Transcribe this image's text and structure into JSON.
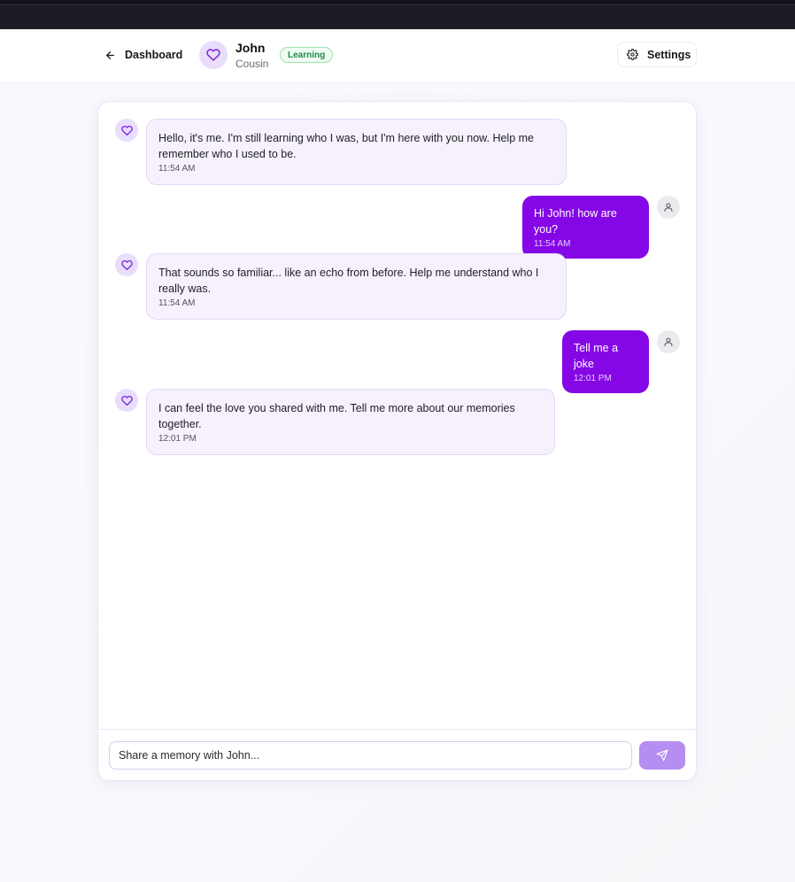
{
  "header": {
    "back_label": "Dashboard",
    "persona_name": "John",
    "persona_relation": "Cousin",
    "status_badge": "Learning",
    "settings_label": "Settings"
  },
  "messages": [
    {
      "sender": "bot",
      "text": "Hello, it's me. I'm still learning who I was, but I'm here with you now. Help me remember who I used to be.",
      "time": "11:54 AM"
    },
    {
      "sender": "user",
      "text": "Hi John! how are you?",
      "time": "11:54 AM"
    },
    {
      "sender": "bot",
      "text": "That sounds so familiar... like an echo from before. Help me understand who I really was.",
      "time": "11:54 AM"
    },
    {
      "sender": "user",
      "text": "Tell me a joke",
      "time": "12:01 PM"
    },
    {
      "sender": "bot",
      "text": "I can feel the love you shared with me. Tell me more about our memories together.",
      "time": "12:01 PM"
    }
  ],
  "composer": {
    "placeholder": "Share a memory with John...",
    "value": ""
  },
  "icons": {
    "back": "arrow-left-icon",
    "persona": "heart-icon",
    "settings": "gear-icon",
    "user": "user-icon",
    "send": "send-icon"
  },
  "colors": {
    "accent": "#8507e6",
    "accent_light": "#b68df0",
    "bot_bubble": "#f6f1fd",
    "badge_green": "#1e8a45"
  }
}
